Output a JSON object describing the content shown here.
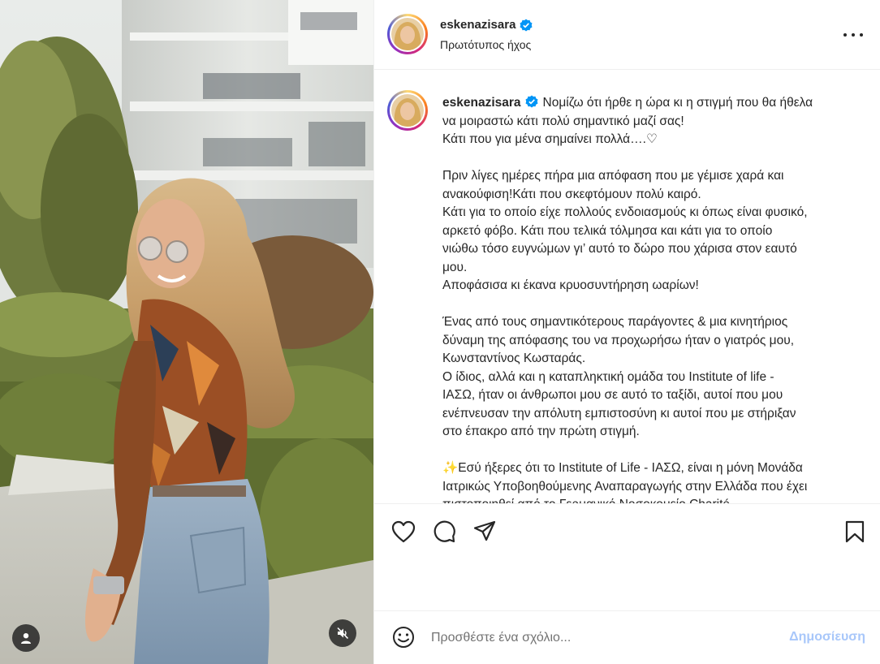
{
  "post": {
    "username": "eskenazisara",
    "audio_label": "Πρωτότυπος ήχος",
    "verified": true
  },
  "caption": {
    "lines": [
      "Νομίζω ότι ήρθε η ώρα κι η στιγμή που θα ήθελα",
      "να μοιραστώ κάτι πολύ σημαντικό μαζί σας!",
      "Κάτι που για μένα σημαίνει πολλά….♡",
      "",
      "Πριν λίγες ημέρες πήρα μια απόφαση που με γέμισε χαρά και",
      "ανακούφιση!Κάτι που σκεφτόμουν πολύ καιρό.",
      "Κάτι για το οποίο είχε πολλούς ενδοιασμούς κι όπως είναι φυσικό,",
      "αρκετό φόβο. Κάτι που τελικά τόλμησα και κάτι για το οποίο",
      "νιώθω τόσο ευγνώμων γι’ αυτό το δώρο που χάρισα στον εαυτό",
      "μου.",
      "Αποφάσισα κι έκανα κρυοσυντήρηση ωαρίων!",
      "",
      "Ένας από τους σημαντικότερους παράγοντες & μια κινητήριος",
      "δύναμη της απόφασης του να προχωρήσω ήταν ο γιατρός μου,",
      "Κωνσταντίνος Κωσταράς.",
      "Ο ίδιος, αλλά και η καταπληκτική ομάδα του Institute of life -",
      "ΙΑΣΩ, ήταν οι άνθρωποι μου σε αυτό το ταξίδι, αυτοί που μου",
      "ενέπνευσαν την απόλυτη εμπιστοσύνη κι αυτοί που με στήριξαν",
      "στο έπακρο από την πρώτη στιγμή.",
      "",
      "✨Εσύ ήξερες ότι το Institute of Life - ΙΑΣΩ, είναι η μόνη Μονάδα",
      "Ιατρικώς Υποβοηθούμενης Αναπαραγωγής στην Ελλάδα που έχει",
      "πιστοποιηθεί από το Γερμανικό Νοσοκομείο Charité"
    ]
  },
  "comment_bar": {
    "placeholder": "Προσθέστε ένα σχόλιο...",
    "post_label": "Δημοσίευση"
  },
  "colors": {
    "verified": "#0095f6",
    "post_button_disabled": "#a8c7fa",
    "text": "#262626",
    "secondary_text": "#737373"
  },
  "icons": [
    "more-options-icon",
    "heart-icon",
    "comment-icon",
    "share-icon",
    "bookmark-icon",
    "emoji-icon",
    "user-icon",
    "muted-icon",
    "verified-badge-icon"
  ]
}
